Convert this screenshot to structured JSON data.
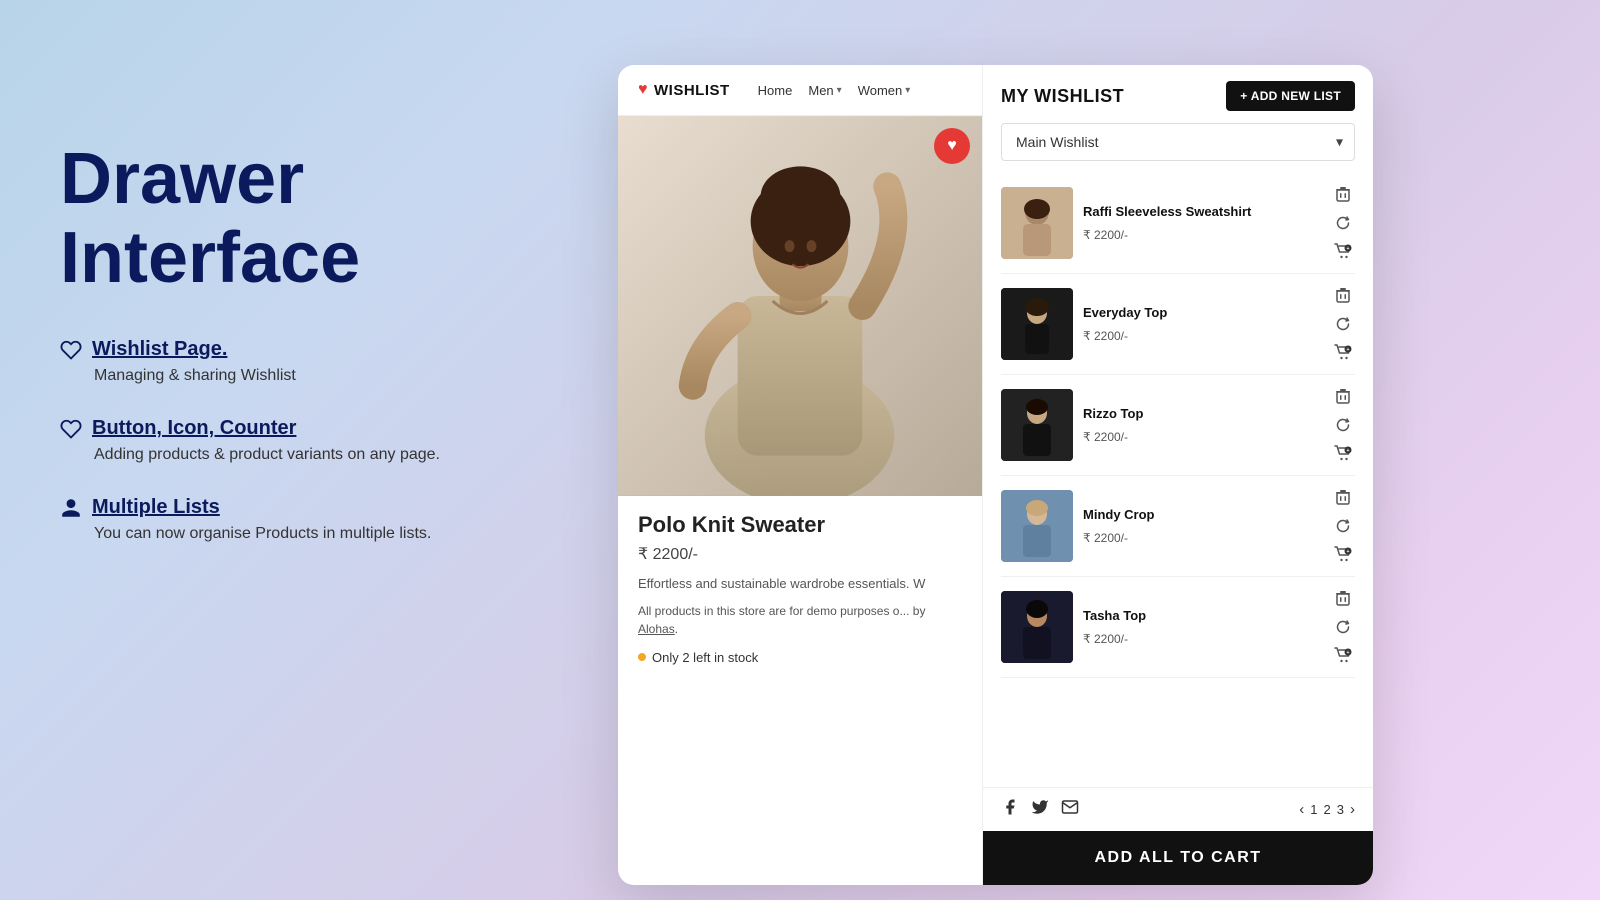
{
  "left": {
    "title_line1": "Drawer",
    "title_line2": "Interface",
    "features": [
      {
        "icon": "heart-outline",
        "heading": "Wishlist Page.",
        "desc": "Managing & sharing Wishlist"
      },
      {
        "icon": "heart-outline",
        "heading": "Button, Icon, Counter",
        "desc": "Adding products & product variants on any page."
      },
      {
        "icon": "person",
        "heading": "Multiple Lists",
        "desc": "You can now organise Products in multiple lists."
      }
    ]
  },
  "nav": {
    "logo": "WISHLIST",
    "home": "Home",
    "men": "Men",
    "women": "Women"
  },
  "product": {
    "name": "Polo Knit Sweater",
    "price": "₹ 2200/-",
    "description": "Effortless and sustainable wardrobe essentials. W",
    "store_notice": "All products in this store are for demo purposes o... by Alohas.",
    "stock": "Only 2 left in stock"
  },
  "drawer": {
    "title": "MY WISHLIST",
    "add_new_label": "+ ADD NEW LIST",
    "select_options": [
      "Main Wishlist"
    ],
    "selected": "Main Wishlist",
    "items": [
      {
        "name": "Raffi Sleeveless Sweatshirt",
        "price": "₹ 2200/-",
        "thumb_class": "item-thumb-1"
      },
      {
        "name": "Everyday Top",
        "price": "₹ 2200/-",
        "thumb_class": "item-thumb-2"
      },
      {
        "name": "Rizzo Top",
        "price": "₹ 2200/-",
        "thumb_class": "item-thumb-3"
      },
      {
        "name": "Mindy Crop",
        "price": "₹ 2200/-",
        "thumb_class": "item-thumb-4"
      },
      {
        "name": "Tasha Top",
        "price": "₹ 2200/-",
        "thumb_class": "item-thumb-5"
      }
    ],
    "pagination": {
      "pages": [
        "1",
        "2",
        "3"
      ]
    },
    "add_all_label": "ADD ALL TO  CART"
  }
}
